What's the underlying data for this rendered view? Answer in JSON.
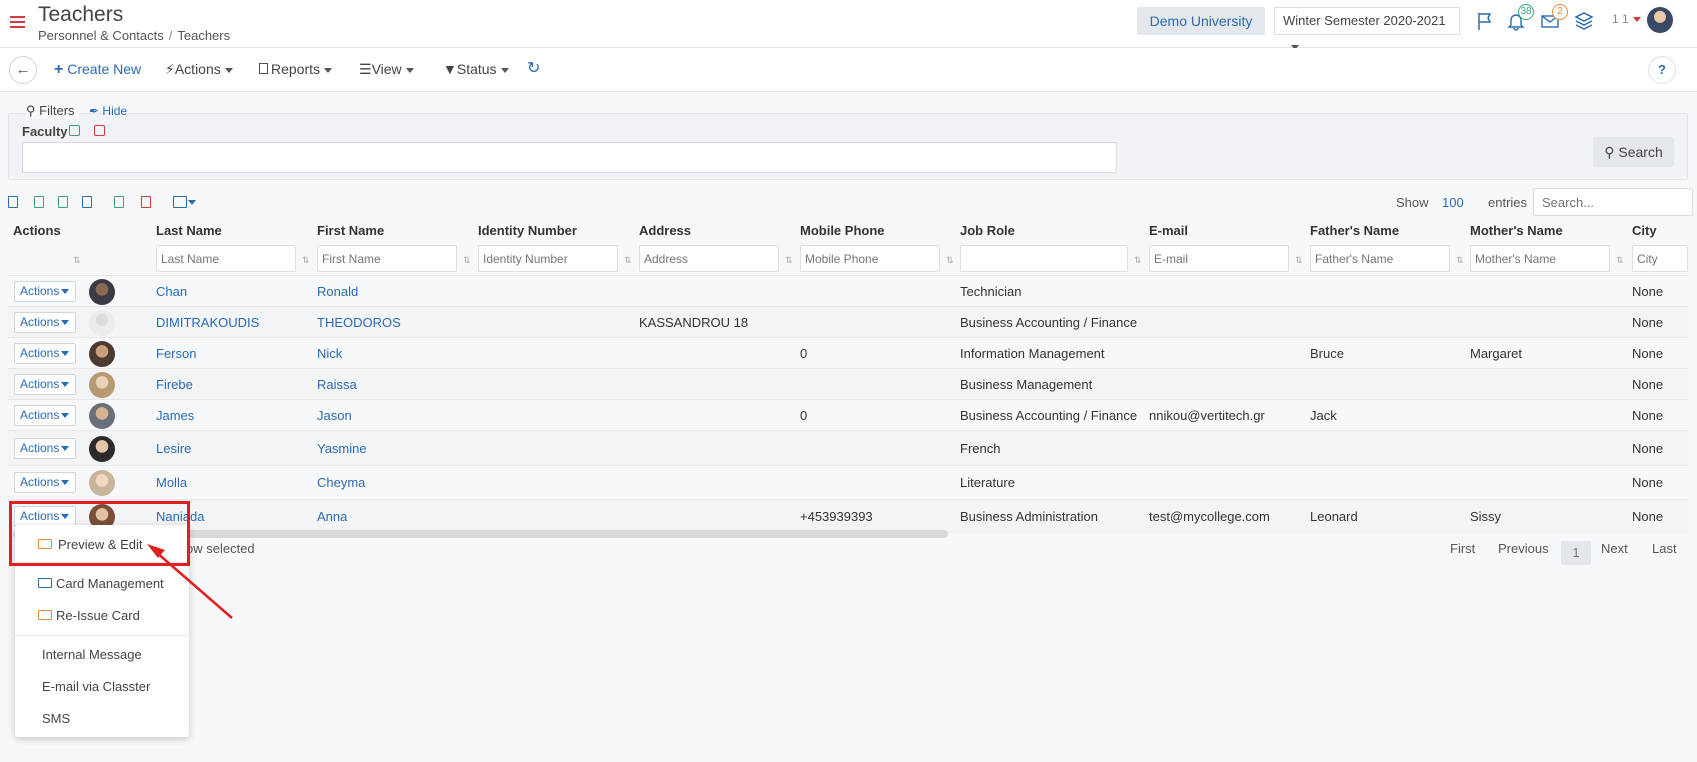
{
  "header": {
    "title": "Teachers",
    "breadcrumb": [
      "Personnel & Contacts",
      "Teachers"
    ],
    "university": "Demo University",
    "semester": "Winter Semester 2020-2021",
    "notifications_count": "38",
    "messages_count": "2",
    "user_number": "1 1"
  },
  "toolbar": {
    "create_new": "Create New",
    "actions": "Actions",
    "reports": "Reports",
    "view": "View",
    "status": "Status",
    "help": "?"
  },
  "filters": {
    "legend": "Filters",
    "hide": "Hide",
    "faculty_label": "Faculty",
    "search_button": "Search"
  },
  "table_controls": {
    "show_label": "Show",
    "show_value": "100",
    "entries_label": "entries",
    "search_placeholder": "Search..."
  },
  "table": {
    "columns": [
      "Actions",
      "Last Name",
      "First Name",
      "Identity Number",
      "Address",
      "Mobile Phone",
      "Job Role",
      "E-mail",
      "Father's Name",
      "Mother's Name",
      "City"
    ],
    "filter_placeholders": [
      "Last Name",
      "First Name",
      "Identity Number",
      "Address",
      "Mobile Phone",
      "",
      "E-mail",
      "Father's Name",
      "Mother's Name",
      "City"
    ],
    "action_label": "Actions",
    "rows": [
      {
        "last": "Chan",
        "first": "Ronald",
        "address": "",
        "mobile": "",
        "job": "Technician",
        "email": "",
        "father": "",
        "mother": "",
        "city": "None"
      },
      {
        "last": "DIMITRAKOUDIS",
        "first": "THEODOROS",
        "address": "KASSANDROU 18",
        "mobile": "",
        "job": "Business Accounting / Finance",
        "email": "",
        "father": "",
        "mother": "",
        "city": "None"
      },
      {
        "last": "Ferson",
        "first": "Nick",
        "address": "",
        "mobile": "0",
        "job": "Information Management",
        "email": "",
        "father": "Bruce",
        "mother": "Margaret",
        "city": "None"
      },
      {
        "last": "Firebe",
        "first": "Raissa",
        "address": "",
        "mobile": "",
        "job": "Business Management",
        "email": "",
        "father": "",
        "mother": "",
        "city": "None"
      },
      {
        "last": "James",
        "first": "Jason",
        "address": "",
        "mobile": "0",
        "job": "Business Accounting / Finance",
        "email": "nnikou@vertitech.gr",
        "father": "Jack",
        "mother": "",
        "city": "None"
      },
      {
        "last": "Lesire",
        "first": "Yasmine",
        "address": "",
        "mobile": "",
        "job": "French",
        "email": "",
        "father": "",
        "mother": "",
        "city": "None"
      },
      {
        "last": "Molla",
        "first": "Cheyma",
        "address": "",
        "mobile": "",
        "job": "Literature",
        "email": "",
        "father": "",
        "mother": "",
        "city": "None"
      },
      {
        "last": "Naniada",
        "first": "Anna",
        "address": "",
        "mobile": "+453939393",
        "job": "Business Administration",
        "email": "test@mycollege.com",
        "father": "Leonard",
        "mother": "Sissy",
        "city": "None"
      }
    ]
  },
  "footer": {
    "row_selected": "ow selected",
    "first": "First",
    "previous": "Previous",
    "current_page": "1",
    "next": "Next",
    "last": "Last"
  },
  "dropdown": {
    "items": [
      "Preview & Edit",
      "Card Management",
      "Re-Issue Card",
      "Internal Message",
      "E-mail via Classter",
      "SMS"
    ]
  },
  "colors": {
    "accent": "#2a6bb3",
    "danger": "#e02020",
    "success": "#3aa572",
    "warning": "#e58a3a"
  }
}
